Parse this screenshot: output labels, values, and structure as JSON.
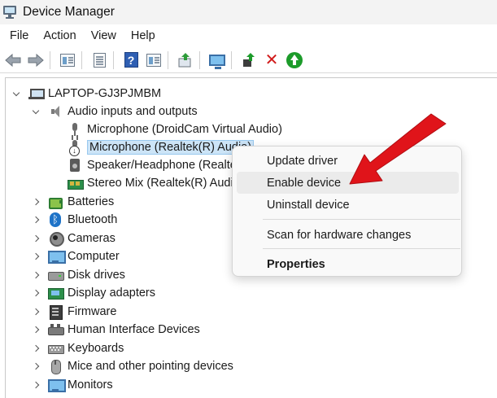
{
  "window": {
    "title": "Device Manager"
  },
  "menu": [
    "File",
    "Action",
    "View",
    "Help"
  ],
  "toolbar": {
    "icons": [
      "back-arrow-icon",
      "forward-arrow-icon",
      "show-hide-console-tree-icon",
      "properties-icon",
      "help-icon",
      "action-pane-icon",
      "update-driver-icon",
      "scan-hardware-icon",
      "add-driver-icon",
      "uninstall-icon",
      "enable-device-icon"
    ]
  },
  "tree": {
    "root": "LAPTOP-GJ3PJMBM",
    "audio_group": "Audio inputs and outputs",
    "audio_children": [
      "Microphone (DroidCam Virtual Audio)",
      "Microphone (Realtek(R) Audio)",
      "Speaker/Headphone (Realtek(R) Audio)",
      "Stereo Mix (Realtek(R) Audio)"
    ],
    "categories": [
      "Batteries",
      "Bluetooth",
      "Cameras",
      "Computer",
      "Disk drives",
      "Display adapters",
      "Firmware",
      "Human Interface Devices",
      "Keyboards",
      "Mice and other pointing devices",
      "Monitors"
    ]
  },
  "context_menu": {
    "items": [
      "Update driver",
      "Enable device",
      "Uninstall device",
      "Scan for hardware changes",
      "Properties"
    ],
    "highlighted": "Enable device"
  },
  "colors": {
    "selection": "#cce4f7",
    "arrow": "#e0141a",
    "accent": "#1e73c8"
  }
}
